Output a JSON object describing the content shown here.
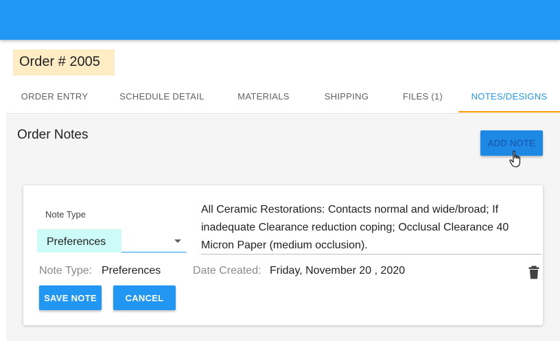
{
  "order": {
    "title": "Order # 2005"
  },
  "tabs": [
    {
      "label": "ORDER ENTRY",
      "active": false
    },
    {
      "label": "SCHEDULE DETAIL",
      "active": false
    },
    {
      "label": "MATERIALS",
      "active": false
    },
    {
      "label": "SHIPPING",
      "active": false
    },
    {
      "label": "FILES (1)",
      "active": false
    },
    {
      "label": "NOTES/DESIGNS",
      "active": true
    }
  ],
  "notes": {
    "section_title": "Order Notes",
    "add_label": "ADD NOTE",
    "card": {
      "note_type_label": "Note Type",
      "note_type_value": "Preferences",
      "note_text": "All Ceramic Restorations: Contacts normal and wide/broad; If inadequate Clearance reduction coping; Occlusal Clearance 40 Micron Paper (medium occlusion).",
      "meta_type_label": "Note Type:",
      "meta_type_value": "Preferences",
      "date_label": "Date Created:",
      "date_value": "Friday, November 20 , 2020",
      "save_label": "SAVE NOTE",
      "cancel_label": "CANCEL"
    }
  },
  "colors": {
    "primary": "#2196f3",
    "tab_indicator": "#ff9800",
    "title_highlight": "#ffecc4",
    "select_highlight": "#ccfbf8"
  },
  "icons": {
    "cursor": "hand-pointer-icon",
    "delete": "trash-icon",
    "dropdown": "caret-down-icon"
  }
}
